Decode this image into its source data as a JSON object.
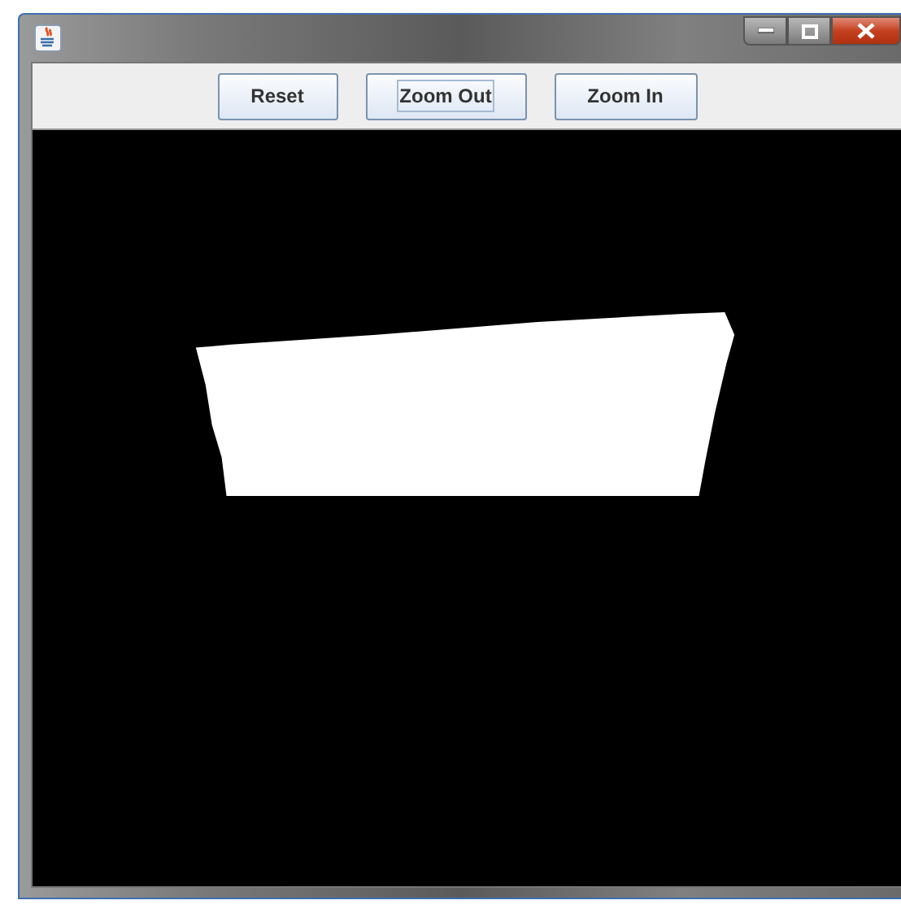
{
  "window": {
    "title_bar": {
      "controls": [
        {
          "kind": "minimize"
        },
        {
          "kind": "maximize"
        },
        {
          "kind": "close"
        }
      ]
    }
  },
  "toolbar": {
    "buttons": [
      {
        "label": "Reset",
        "focused": false
      },
      {
        "label": "Zoom Out",
        "focused": true
      },
      {
        "label": "Zoom In",
        "focused": false
      }
    ]
  }
}
